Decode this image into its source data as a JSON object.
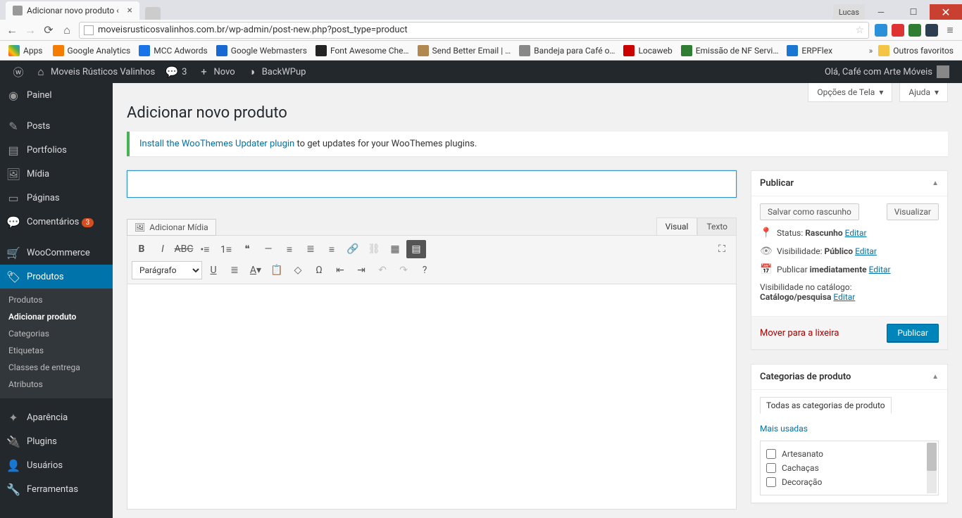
{
  "browser": {
    "tab_title": "Adicionar novo produto ‹",
    "url": "moveisrusticosvalinhos.com.br/wp-admin/post-new.php?post_type=product",
    "win_user": "Lucas",
    "bookmarks_label": "Apps",
    "bookmarks": [
      {
        "label": "Google Analytics",
        "color": "#f57c00"
      },
      {
        "label": "MCC Adwords",
        "color": "#1a73e8"
      },
      {
        "label": "Google Webmasters",
        "color": "#1967d2"
      },
      {
        "label": "Font Awesome Che…",
        "color": "#222"
      },
      {
        "label": "Send Better Email | …",
        "color": "#b08850"
      },
      {
        "label": "Bandeja para Café o…",
        "color": "#888"
      },
      {
        "label": "Locaweb",
        "color": "#c00"
      },
      {
        "label": "Emissão de NF Servi…",
        "color": "#2e7d32"
      },
      {
        "label": "ERPFlex",
        "color": "#1976d2"
      }
    ],
    "other_bookmarks": "Outros favoritos"
  },
  "adminbar": {
    "site_name": "Moveis Rústicos Valinhos",
    "comments": "3",
    "new_label": "Novo",
    "backwpup": "BackWPup",
    "greeting": "Olá, Café com Arte Móveis"
  },
  "adminmenu": {
    "items": [
      {
        "label": "Painel",
        "icon": "◉"
      },
      {
        "label": "Posts",
        "icon": "✎"
      },
      {
        "label": "Portfolios",
        "icon": "▤"
      },
      {
        "label": "Mídia",
        "icon": "🖼"
      },
      {
        "label": "Páginas",
        "icon": "▭"
      },
      {
        "label": "Comentários",
        "icon": "💬",
        "badge": "3"
      },
      {
        "label": "WooCommerce",
        "icon": "🛒"
      },
      {
        "label": "Produtos",
        "icon": "🏷",
        "current": true
      },
      {
        "label": "Aparência",
        "icon": "✦"
      },
      {
        "label": "Plugins",
        "icon": "🔌"
      },
      {
        "label": "Usuários",
        "icon": "👤"
      },
      {
        "label": "Ferramentas",
        "icon": "🔧"
      }
    ],
    "submenu": [
      {
        "label": "Produtos"
      },
      {
        "label": "Adicionar produto",
        "current": true
      },
      {
        "label": "Categorias"
      },
      {
        "label": "Etiquetas"
      },
      {
        "label": "Classes de entrega"
      },
      {
        "label": "Atributos"
      }
    ]
  },
  "screen_options": {
    "options": "Opções de Tela",
    "help": "Ajuda"
  },
  "page": {
    "title": "Adicionar novo produto",
    "notice_link": "Install the WooThemes Updater plugin",
    "notice_text": " to get updates for your WooThemes plugins.",
    "title_value": ""
  },
  "editor": {
    "add_media": "Adicionar Mídia",
    "visual_tab": "Visual",
    "text_tab": "Texto",
    "paragraph": "Parágrafo"
  },
  "publish": {
    "heading": "Publicar",
    "save_draft": "Salvar como rascunho",
    "preview": "Visualizar",
    "status_label": "Status: ",
    "status_value": "Rascunho",
    "visibility_label": "Visibilidade: ",
    "visibility_value": "Público",
    "publish_label": "Publicar ",
    "publish_value": "imediatamente",
    "catalog_label": "Visibilidade no catálogo:",
    "catalog_value": "Catálogo/pesquisa",
    "edit": "Editar",
    "trash": "Mover para a lixeira",
    "publish_btn": "Publicar"
  },
  "categories": {
    "heading": "Categorias de produto",
    "tab_all": "Todas as categorias de produto",
    "tab_used": "Mais usadas",
    "items": [
      "Artesanato",
      "Cachaças",
      "Decoração"
    ]
  }
}
